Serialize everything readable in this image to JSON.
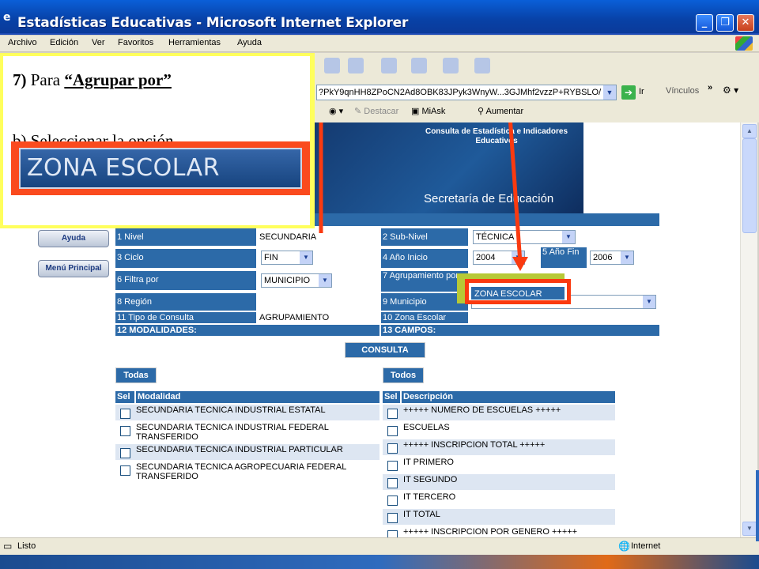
{
  "window": {
    "title": "Estadísticas Educativas - Microsoft Internet Explorer"
  },
  "menu": [
    "Archivo",
    "Edición",
    "Ver",
    "Favoritos",
    "Herramientas",
    "Ayuda"
  ],
  "toolbar": {
    "address": "?PkY9qnHH8ZPoCN2Ad8OBK83JPyk3WnyW...3GJMhf2vzzP+RYBSLO/",
    "go_label": "Ir",
    "links_label": "Vínculos",
    "buttons": [
      "Destacar",
      "MiAsk",
      "Aumentar"
    ]
  },
  "banner": {
    "title": "Consulta de Estadística e Indicadores Educativos",
    "subtitle": "Secretaría de Educación"
  },
  "nav": [
    "Ayuda",
    "Menú Principal"
  ],
  "form": {
    "header": "ADISTICAS EDUCATIVAS",
    "fields": {
      "nivel_label": "1 Nivel",
      "nivel_value": "SECUNDARIA",
      "subnivel_label": "2 Sub-Nivel",
      "subnivel_value": "TÉCNICA",
      "ciclo_label": "3 Ciclo",
      "ciclo_value": "FIN",
      "anio_inicio_label": "4 Año Inicio",
      "anio_inicio_value": "2004",
      "anio_fin_label": "5 Año Fin",
      "anio_fin_value": "2006",
      "filtra_label": "6 Filtra por",
      "filtra_value": "MUNICIPIO",
      "agrupamiento_label": "7 Agrupamiento por",
      "agrupamiento_value": "ZONA ESCOLAR",
      "region_label": "8 Región",
      "municipio_label": "9 Municipio",
      "zona_label": "10 Zona Escolar",
      "tipo_label": "11 Tipo de Consulta",
      "tipo_value": "AGRUPAMIENTO",
      "modalidades_label": "12 MODALIDADES:",
      "campos_label": "13 CAMPOS:"
    },
    "consulta_button": "CONSULTA",
    "todas_button": "Todas",
    "todos_button": "Todos",
    "modalidades_headers": [
      "Sel",
      "Modalidad"
    ],
    "modalidades": [
      [
        "SECUNDARIA TECNICA INDUSTRIAL ESTATAL"
      ],
      [
        "SECUNDARIA TECNICA INDUSTRIAL FEDERAL",
        "TRANSFERIDO"
      ],
      [
        "SECUNDARIA TECNICA INDUSTRIAL PARTICULAR"
      ],
      [
        "SECUNDARIA TECNICA AGROPECUARIA FEDERAL",
        "TRANSFERIDO"
      ]
    ],
    "campos_headers": [
      "Sel",
      "Descripción"
    ],
    "campos": [
      "+++++ NUMERO DE ESCUELAS +++++",
      "ESCUELAS",
      "+++++ INSCRIPCION TOTAL +++++",
      "IT PRIMERO",
      "IT SEGUNDO",
      "IT TERCERO",
      "IT TOTAL",
      "+++++ INSCRIPCION POR GENERO +++++"
    ]
  },
  "callout": {
    "step": "7)",
    "text_before": " Para ",
    "text_emph": "“Agrupar por”",
    "line2": "b) Seleccionar la opción",
    "zoom_label": "ZONA ESCOLAR"
  },
  "status": {
    "left": "Listo",
    "right": "Internet"
  },
  "colors": {
    "accent": "#2c6aa8",
    "highlight_red": "#fa4a1e",
    "callout_border": "#ffff5c"
  }
}
